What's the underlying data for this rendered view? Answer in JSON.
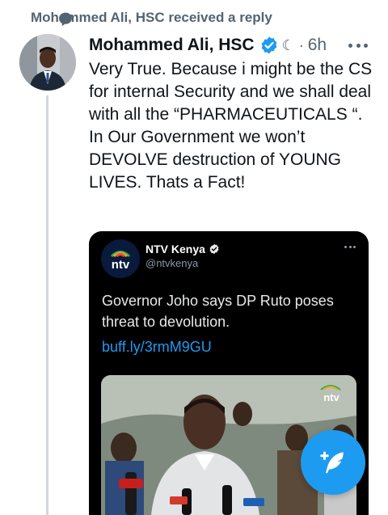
{
  "context": {
    "text": "Mohammed Ali, HSC received a reply",
    "icon": "reply-bubble-icon"
  },
  "tweet": {
    "author": "Mohammed Ali, HSC",
    "meta_glyph": "☾",
    "separator": "·",
    "time": "6h",
    "text": "Very True. Because i might be the CS for internal Security and we shall deal with all the “PHARMACEUTICALS “.  In Our Government we won’t DEVOLVE destruction of YOUNG LIVES. Thats a Fact!"
  },
  "embedded": {
    "account_name": "NTV Kenya",
    "handle": "@ntvkenya",
    "body": "Governor Joho says DP Ruto poses threat to devolution.",
    "link": "buff.ly/3rmM9GU",
    "logo_text": "ntv",
    "watermark_text": "ntv"
  },
  "colors": {
    "accent": "#1d9bf0",
    "muted": "#536471",
    "card_bg": "#000000"
  }
}
